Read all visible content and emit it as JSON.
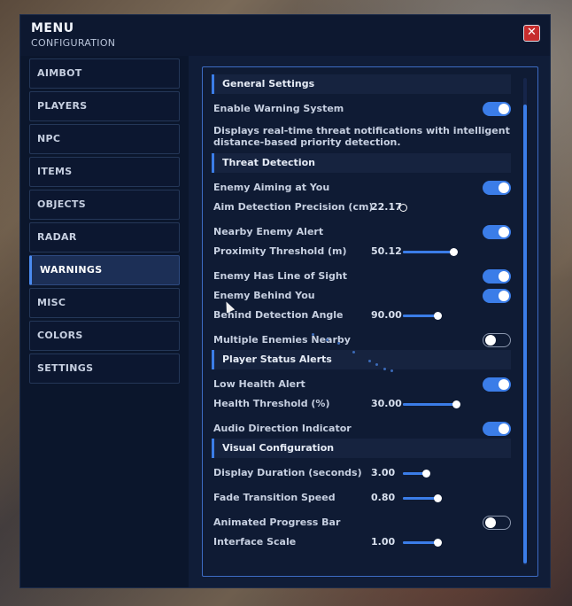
{
  "header": {
    "title": "MENU",
    "subtitle": "CONFIGURATION",
    "close_glyph": "✕"
  },
  "sidebar": {
    "items": [
      {
        "label": "AIMBOT"
      },
      {
        "label": "PLAYERS"
      },
      {
        "label": "NPC"
      },
      {
        "label": "ITEMS"
      },
      {
        "label": "OBJECTS"
      },
      {
        "label": "RADAR"
      },
      {
        "label": "WARNINGS",
        "active": true
      },
      {
        "label": "MISC"
      },
      {
        "label": "COLORS"
      },
      {
        "label": "SETTINGS"
      }
    ]
  },
  "content": {
    "general": {
      "title": "General Settings",
      "enable_warning": {
        "label": "Enable Warning System",
        "on": true
      },
      "description": "Displays real-time threat notifications with intelligent distance-based priority detection."
    },
    "threat": {
      "title": "Threat Detection",
      "enemy_aiming": {
        "label": "Enemy Aiming at You",
        "on": true
      },
      "aim_precision": {
        "label": "Aim Detection Precision (cm)",
        "value": "22.17"
      },
      "nearby_alert": {
        "label": "Nearby Enemy Alert",
        "on": true
      },
      "proximity": {
        "label": "Proximity Threshold (m)",
        "value": "50.12"
      },
      "line_of_sight": {
        "label": "Enemy Has Line of Sight",
        "on": true
      },
      "behind_you": {
        "label": "Enemy Behind You",
        "on": true
      },
      "behind_angle": {
        "label": "Behind Detection Angle",
        "value": "90.00"
      },
      "multiple": {
        "label": "Multiple Enemies Nearby",
        "on": false
      }
    },
    "player_status": {
      "title": "Player Status Alerts",
      "low_health": {
        "label": "Low Health Alert",
        "on": true
      },
      "health_threshold": {
        "label": "Health Threshold (%)",
        "value": "30.00"
      },
      "audio_direction": {
        "label": "Audio Direction Indicator",
        "on": true
      }
    },
    "visual": {
      "title": "Visual Configuration",
      "display_duration": {
        "label": "Display Duration (seconds)",
        "value": "3.00"
      },
      "fade_speed": {
        "label": "Fade Transition Speed",
        "value": "0.80"
      },
      "progress_bar": {
        "label": "Animated Progress Bar",
        "on": false
      },
      "interface_scale": {
        "label": "Interface Scale",
        "value": "1.00"
      }
    }
  },
  "colors": {
    "accent": "#3b7de8",
    "close": "#c62d2d",
    "panel": "#0f1b34"
  }
}
